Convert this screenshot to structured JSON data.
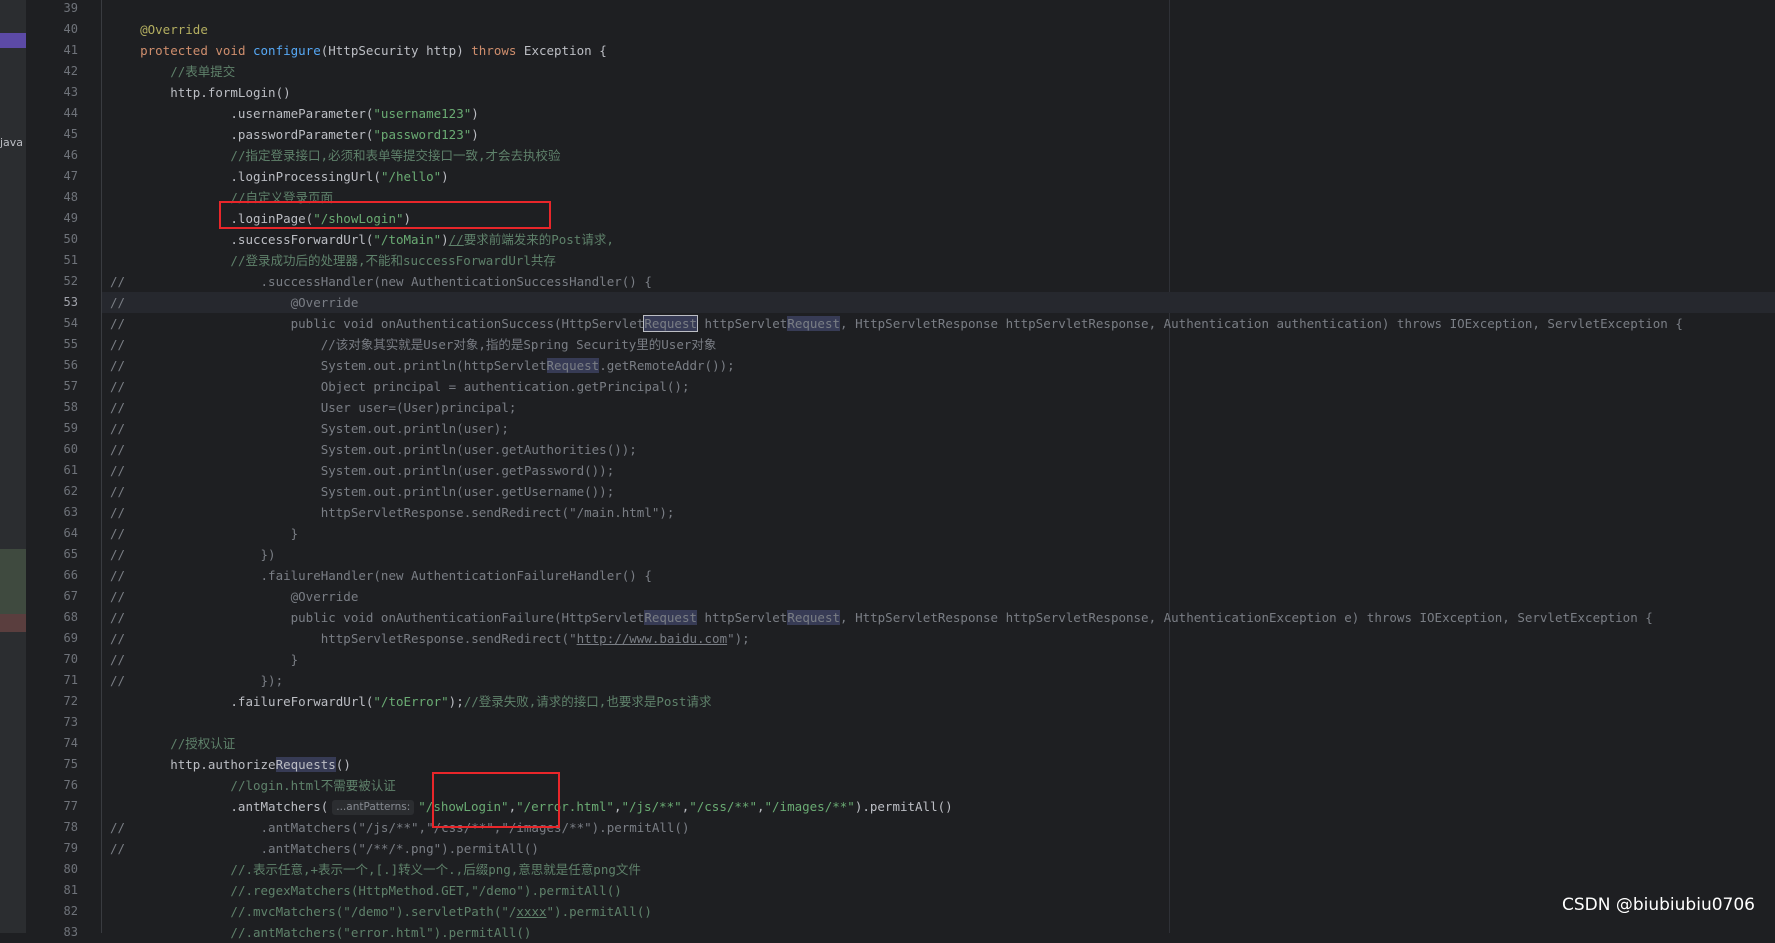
{
  "side": {
    "file_label": "java"
  },
  "lines": [
    {
      "n": "39",
      "t": ""
    },
    {
      "n": "40",
      "t": "    <span class='ann'>@Override</span>"
    },
    {
      "n": "41",
      "t": "    <span class='kw'>protected void</span> <span class='fn'>configure</span>(HttpSecurity http) <span class='kw'>throws</span> Exception {"
    },
    {
      "n": "42",
      "t": "        <span class='cmt'>//表单提交</span>"
    },
    {
      "n": "43",
      "t": "        http.formLogin()"
    },
    {
      "n": "44",
      "t": "                .usernameParameter(<span class='str'>\"username123\"</span>)"
    },
    {
      "n": "45",
      "t": "                .passwordParameter(<span class='str'>\"password123\"</span>)"
    },
    {
      "n": "46",
      "t": "                <span class='cmt'>//指定登录接口,必须和表单等提交接口一致,才会去执校验</span>"
    },
    {
      "n": "47",
      "t": "                .loginProcessingUrl(<span class='str'>\"/hello\"</span>)"
    },
    {
      "n": "48",
      "t": "                <span class='cmt'>//自定义登录页面</span>"
    },
    {
      "n": "49",
      "t": "                .loginPage(<span class='str'>\"/showLogin\"</span>)"
    },
    {
      "n": "50",
      "t": "                .successForwardUrl(<span class='str'>\"/toMain\"</span>)<span class='cmt'><span class='ul'>//</span>要求前端发来的Post请求,</span>"
    },
    {
      "n": "51",
      "t": "                <span class='cmt'>//登录成功后的处理器,不能和successForwardUrl共存</span>"
    },
    {
      "n": "52",
      "t": "<span class='cc'>//                  .successHandler(new AuthenticationSuccessHandler() {</span>"
    },
    {
      "n": "53",
      "t": "<span class='cc'>//                      @Override</span>"
    },
    {
      "n": "54",
      "t": "<span class='cc'>//                      public void onAuthenticationSuccess(HttpServlet<span class='hl box-caret'>Request</span> httpServlet<span class='hl'>Request</span>, HttpServletResponse httpServletResponse, Authentication authentication) throws IOException, ServletException {</span>"
    },
    {
      "n": "55",
      "t": "<span class='cc'>//                          //该对象其实就是User对象,指的是Spring Security里的User对象</span>"
    },
    {
      "n": "56",
      "t": "<span class='cc'>//                          System.out.println(httpServlet<span class='hl'>Request</span>.getRemoteAddr());</span>"
    },
    {
      "n": "57",
      "t": "<span class='cc'>//                          Object principal = authentication.getPrincipal();</span>"
    },
    {
      "n": "58",
      "t": "<span class='cc'>//                          User user=(User)principal;</span>"
    },
    {
      "n": "59",
      "t": "<span class='cc'>//                          System.out.println(user);</span>"
    },
    {
      "n": "60",
      "t": "<span class='cc'>//                          System.out.println(user.getAuthorities());</span>"
    },
    {
      "n": "61",
      "t": "<span class='cc'>//                          System.out.println(user.getPassword());</span>"
    },
    {
      "n": "62",
      "t": "<span class='cc'>//                          System.out.println(user.getUsername());</span>"
    },
    {
      "n": "63",
      "t": "<span class='cc'>//                          httpServletResponse.sendRedirect(\"/main.html\");</span>"
    },
    {
      "n": "64",
      "t": "<span class='cc'>//                      }</span>"
    },
    {
      "n": "65",
      "t": "<span class='cc'>//                  })</span>"
    },
    {
      "n": "66",
      "t": "<span class='cc'>//                  .failureHandler(new AuthenticationFailureHandler() {</span>"
    },
    {
      "n": "67",
      "t": "<span class='cc'>//                      @Override</span>"
    },
    {
      "n": "68",
      "t": "<span class='cc'>//                      public void onAuthenticationFailure(HttpServlet<span class='hl'>Request</span> httpServlet<span class='hl'>Request</span>, HttpServletResponse httpServletResponse, AuthenticationException e) throws IOException, ServletException {</span>"
    },
    {
      "n": "69",
      "t": "<span class='cc'>//                          httpServletResponse.sendRedirect(\"<span class='ul'>http://www.baidu.com</span>\");</span>"
    },
    {
      "n": "70",
      "t": "<span class='cc'>//                      }</span>"
    },
    {
      "n": "71",
      "t": "<span class='cc'>//                  });</span>"
    },
    {
      "n": "72",
      "t": "                .failureForwardUrl(<span class='str'>\"/toError\"</span>);<span class='cmt'>//登录失败,请求的接口,也要求是Post请求</span>"
    },
    {
      "n": "73",
      "t": ""
    },
    {
      "n": "74",
      "t": "        <span class='cmt'>//授权认证</span>"
    },
    {
      "n": "75",
      "t": "        http.authorize<span class='hl'>Requests</span>()"
    },
    {
      "n": "76",
      "t": "                <span class='cmt'>//login.html不需要被认证</span>"
    },
    {
      "n": "77",
      "t": "                .antMatchers(<span class='hint'>...antPatterns:</span><span class='str'>\"/showLogin\"</span>,<span class='str'>\"/error.html\"</span>,<span class='str'>\"/js/**\"</span>,<span class='str'>\"/css/**\"</span>,<span class='str'>\"/images/**\"</span>).permitAll()"
    },
    {
      "n": "78",
      "t": "<span class='cc'>//                  .antMatchers(\"/js/**\",\"/css/**\",\"/images/**\").permitAll()</span>"
    },
    {
      "n": "79",
      "t": "<span class='cc'>//                  .antMatchers(\"/**/*.png\").permitAll()</span>"
    },
    {
      "n": "80",
      "t": "                <span class='cmt'>//.表示任意,+表示一个,[.]转义一个.,后缀png,意思就是任意png文件</span>"
    },
    {
      "n": "81",
      "t": "                <span class='cmt'>//.regexMatchers(HttpMethod.GET,\"/demo\").permitAll()</span>"
    },
    {
      "n": "82",
      "t": "                <span class='cmt'>//.mvcMatchers(\"/demo\").servletPath(\"/<span class='ul'>xxxx</span>\").permitAll()</span>"
    },
    {
      "n": "83",
      "t": "                <span class='cmt'>//.antMatchers(\"error.html\").permitAll()</span>"
    }
  ],
  "watermark": "CSDN @biubiubiu0706"
}
